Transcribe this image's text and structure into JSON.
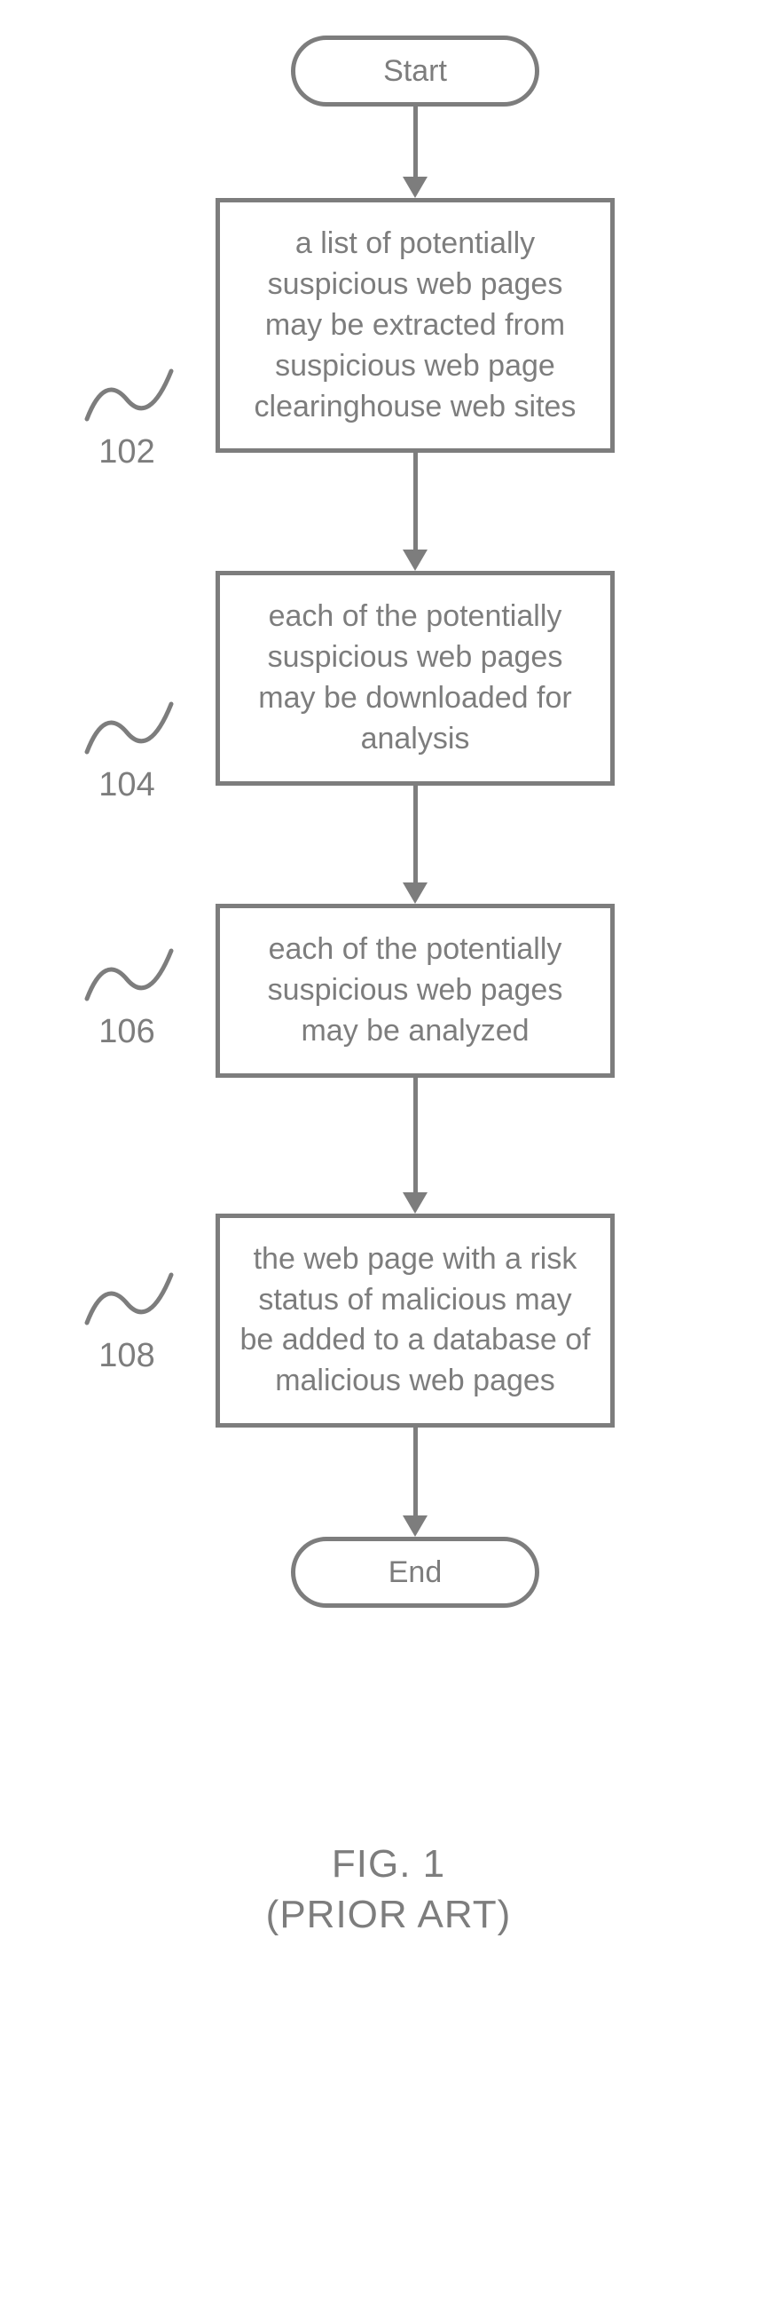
{
  "flow": {
    "start": "Start",
    "end": "End",
    "steps": [
      {
        "ref": "102",
        "text": "a list of potentially suspicious web pages may be extracted from suspicious web page clearinghouse web sites"
      },
      {
        "ref": "104",
        "text": "each of the potentially suspicious web pages may be downloaded for analysis"
      },
      {
        "ref": "106",
        "text": "each of the potentially suspicious web pages may be analyzed"
      },
      {
        "ref": "108",
        "text": "the web page with a risk status of malicious may be added to a database of malicious web pages"
      }
    ]
  },
  "caption": {
    "line1": "FIG. 1",
    "line2": "(PRIOR ART)"
  }
}
